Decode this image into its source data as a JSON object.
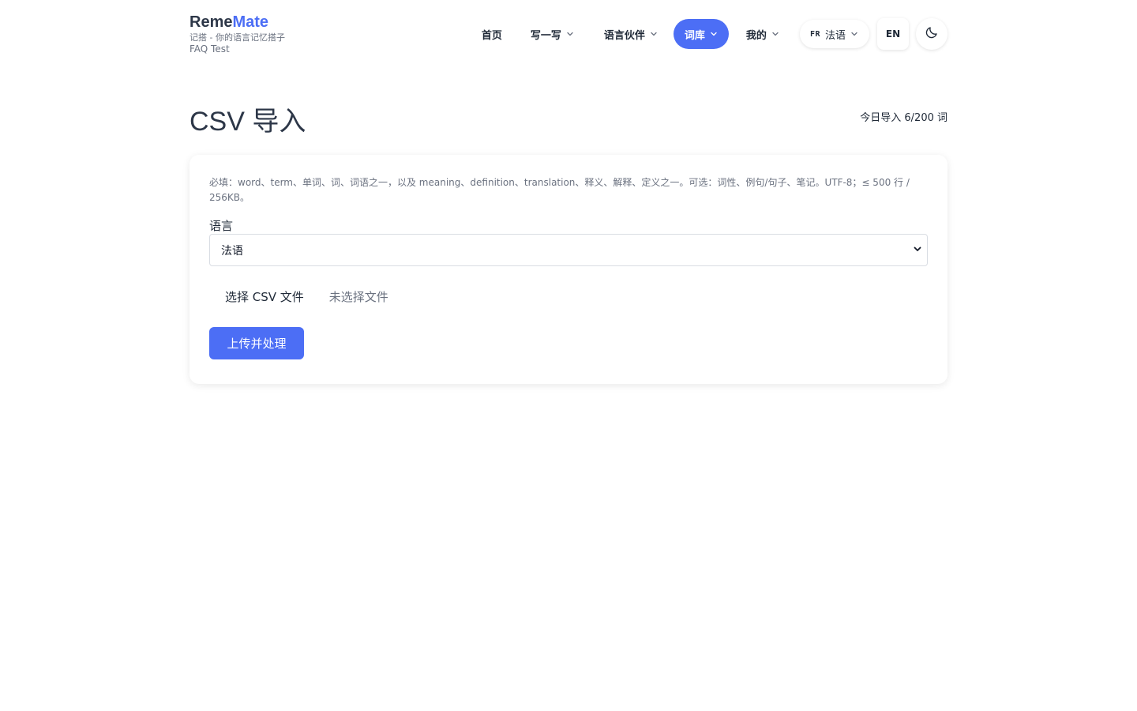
{
  "brand": {
    "title_part1": "Reme",
    "title_part2": "Mate",
    "subtitle": "记搭 - 你的语言记忆搭子",
    "env_label": "FAQ Test"
  },
  "nav": {
    "items": [
      {
        "label": "首页",
        "icon": "",
        "active": false
      },
      {
        "label": "写一写",
        "icon": "chevron-down-icon",
        "active": false
      },
      {
        "label": "语言伙伴",
        "icon": "chevron-down-icon",
        "active": false
      },
      {
        "label": "词库",
        "icon": "chevron-down-icon",
        "active": true
      },
      {
        "label": "我的",
        "icon": "chevron-down-icon",
        "active": false
      }
    ],
    "language": {
      "code": "FR",
      "label": "法语"
    },
    "ui_language": "EN",
    "theme_icon": "moon-icon"
  },
  "page": {
    "title": "CSV 导入",
    "quota": "今日导入 6/200 词"
  },
  "form": {
    "hint": "必填：word、term、单词、词、词语之一，以及 meaning、definition、translation、释义、解释、定义之一。可选：词性、例句/句子、笔记。UTF-8；≤ 500 行 / 256KB。",
    "language_label": "语言",
    "language_value": "法语",
    "file_button": "选择 CSV 文件",
    "file_status": "未选择文件",
    "submit": "上传并处理"
  },
  "colors": {
    "accent": "#4c6ef5",
    "text": "#2d3748",
    "muted": "#6b7280"
  }
}
